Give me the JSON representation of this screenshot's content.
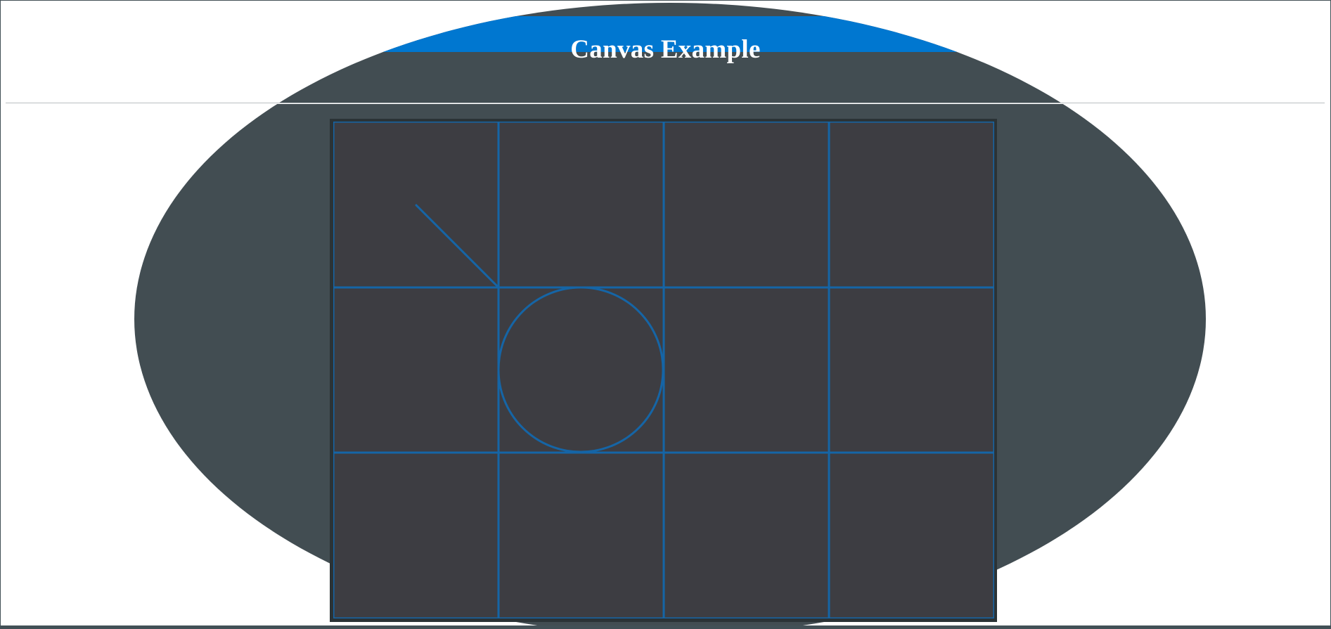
{
  "page": {
    "title": "Canvas Example"
  },
  "colors": {
    "title_band": "#0077d0",
    "ellipse": "#424d52",
    "canvas_bg": "#3d3d42",
    "stroke": "#1565a6"
  },
  "canvas": {
    "grid": {
      "columns": 4,
      "rows": 3
    },
    "shapes": [
      {
        "type": "line",
        "name": "diagonal-line"
      },
      {
        "type": "circle",
        "name": "circle"
      }
    ]
  }
}
